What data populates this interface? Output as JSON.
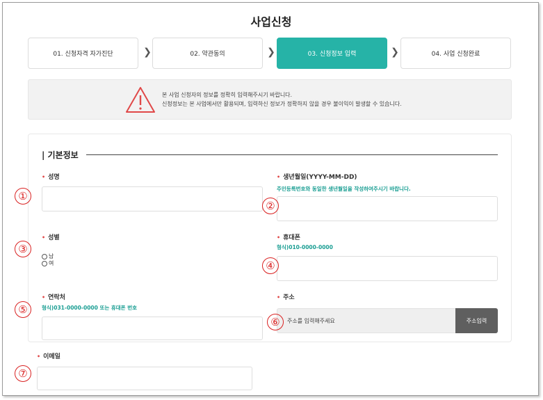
{
  "page": {
    "title": "사업신청"
  },
  "steps": [
    {
      "label": "01. 신청자격 자가진단"
    },
    {
      "label": "02. 약관동의"
    },
    {
      "label": "03. 신청정보 입력"
    },
    {
      "label": "04. 사업 신청완료"
    }
  ],
  "notice": {
    "line1": "본 사업 신청자의 정보를 정확히 입력해주시기 바랍니다.",
    "line2": "신청정보는 본 사업에서만 활용되며, 입력하신 정보가 정확하지 않을 경우 불이익이 발생할 수 있습니다."
  },
  "section": {
    "title": "| 기본정보"
  },
  "fields": {
    "name": {
      "label": "성명",
      "value": ""
    },
    "birth": {
      "label": "생년월일(YYYY-MM-DD)",
      "hint": "주민등록번호와 동일한 생년월일을 작성하여주시기 바랍니다.",
      "value": ""
    },
    "gender": {
      "label": "성별",
      "options": [
        "남",
        "여"
      ]
    },
    "mobile": {
      "label": "휴대폰",
      "hint": "형식)010-0000-0000",
      "value": ""
    },
    "phone": {
      "label": "연락처",
      "hint": "형식)031-0000-0000 또는 휴대폰 번호",
      "value": ""
    },
    "address": {
      "label": "주소",
      "placeholder": "주소를 입력해주세요",
      "button": "주소입력"
    },
    "email": {
      "label": "이메일",
      "value": ""
    }
  },
  "required_mark": "•",
  "markers": [
    "①",
    "②",
    "③",
    "④",
    "⑤",
    "⑥",
    "⑦"
  ],
  "colors": {
    "accent": "#26b3a7",
    "hint": "#1a9e93",
    "required": "#e04848",
    "marker": "#d92020",
    "button": "#5f5f5f"
  }
}
